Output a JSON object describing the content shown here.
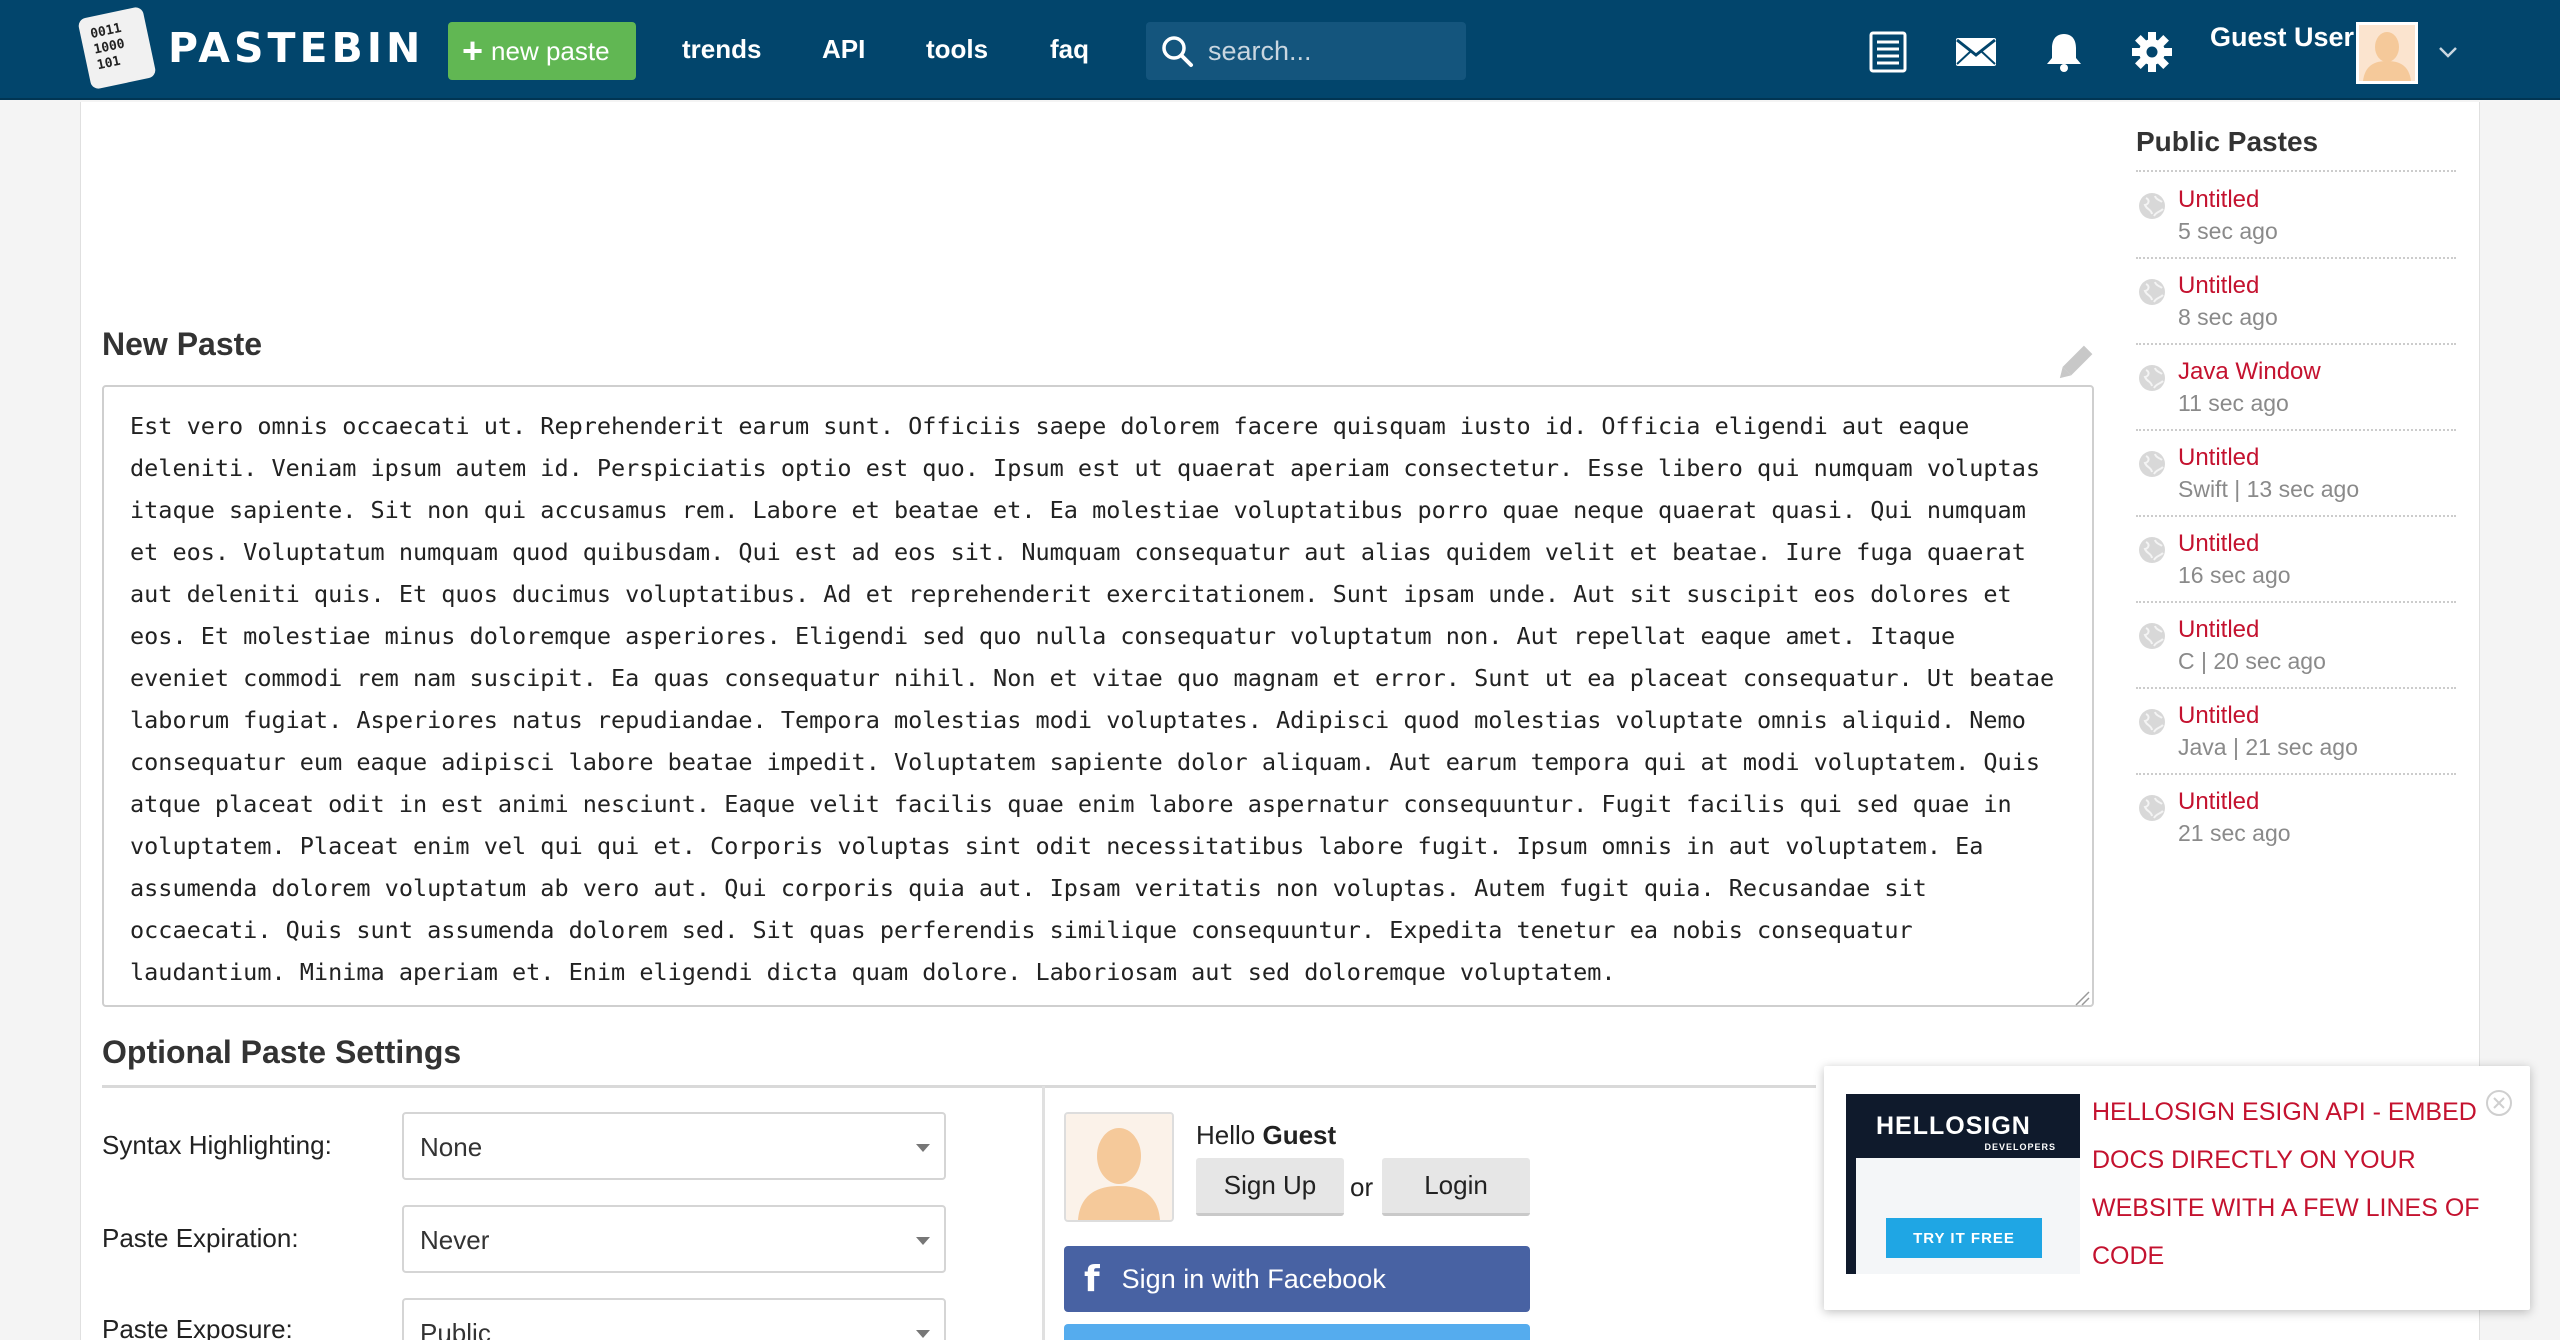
{
  "header": {
    "brand": "PASTEBIN",
    "logo_digits": [
      "0011",
      "1000",
      "101"
    ],
    "new_paste_label": "new paste",
    "nav": [
      "trends",
      "API",
      "tools",
      "faq"
    ],
    "search_placeholder": "search...",
    "user_name": "Guest User",
    "colors": {
      "bar": "#02456c",
      "new_paste": "#61b753"
    }
  },
  "main": {
    "new_paste_title": "New Paste",
    "paste_text": "Est vero omnis occaecati ut. Reprehenderit earum sunt. Officiis saepe dolorem facere quisquam iusto id. Officia eligendi aut eaque deleniti. Veniam ipsum autem id. Perspiciatis optio est quo. Ipsum est ut quaerat aperiam consectetur. Esse libero qui numquam voluptas itaque sapiente. Sit non qui accusamus rem. Labore et beatae et. Ea molestiae voluptatibus porro quae neque quaerat quasi. Qui numquam et eos. Voluptatum numquam quod quibusdam. Qui est ad eos sit. Numquam consequatur aut alias quidem velit et beatae. Iure fuga quaerat aut deleniti quis. Et quos ducimus voluptatibus. Ad et reprehenderit exercitationem. Sunt ipsam unde. Aut sit suscipit eos dolores et eos. Et molestiae minus doloremque asperiores. Eligendi sed quo nulla consequatur voluptatum non. Aut repellat eaque amet. Itaque eveniet commodi rem nam suscipit. Ea quas consequatur nihil. Non et vitae quo magnam et error. Sunt ut ea placeat consequatur. Ut beatae laborum fugiat. Asperiores natus repudiandae. Tempora molestias modi voluptates. Adipisci quod molestias voluptate omnis aliquid. Nemo consequatur eum eaque adipisci labore beatae impedit. Voluptatem sapiente dolor aliquam. Aut earum tempora qui at modi voluptatem. Quis atque placeat odit in est animi nesciunt. Eaque velit facilis quae enim labore aspernatur consequuntur. Fugit facilis qui sed quae in voluptatem. Placeat enim vel qui qui et. Corporis voluptas sint odit necessitatibus labore fugit. Ipsum omnis in aut voluptatem. Ea assumenda dolorem voluptatum ab vero aut. Qui corporis quia aut. Ipsam veritatis non voluptas. Autem fugit quia. Recusandae sit occaecati. Quis sunt assumenda dolorem sed. Sit quas perferendis similique consequuntur. Expedita tenetur ea nobis consequatur laudantium. Minima aperiam et. Enim eligendi dicta quam dolore. Laboriosam aut sed doloremque voluptatem.",
    "settings_title": "Optional Paste Settings",
    "settings": [
      {
        "label": "Syntax Highlighting:",
        "value": "None"
      },
      {
        "label": "Paste Expiration:",
        "value": "Never"
      },
      {
        "label": "Paste Exposure:",
        "value": "Public"
      }
    ]
  },
  "guest": {
    "hello": "Hello",
    "name": "Guest",
    "signup_label": "Sign Up",
    "or": "or",
    "login_label": "Login",
    "facebook_label": "Sign in with Facebook",
    "colors": {
      "facebook": "#4862a3",
      "twitter": "#55acee"
    }
  },
  "sidebar": {
    "title": "Public Pastes",
    "items": [
      {
        "title": "Untitled",
        "meta": "5 sec ago"
      },
      {
        "title": "Untitled",
        "meta": "8 sec ago"
      },
      {
        "title": "Java Window",
        "meta": "11 sec ago"
      },
      {
        "title": "Untitled",
        "meta": "Swift | 13 sec ago"
      },
      {
        "title": "Untitled",
        "meta": "16 sec ago"
      },
      {
        "title": "Untitled",
        "meta": "C | 20 sec ago"
      },
      {
        "title": "Untitled",
        "meta": "Java | 21 sec ago"
      },
      {
        "title": "Untitled",
        "meta": "21 sec ago"
      }
    ],
    "link_color": "#c4122f"
  },
  "ad": {
    "brand": "HELLOSIGN",
    "sub": "DEVELOPERS",
    "cta": "TRY IT FREE",
    "text": "HELLOSIGN ESIGN API - EMBED DOCS DIRECTLY ON YOUR WEBSITE WITH A FEW LINES OF CODE"
  }
}
